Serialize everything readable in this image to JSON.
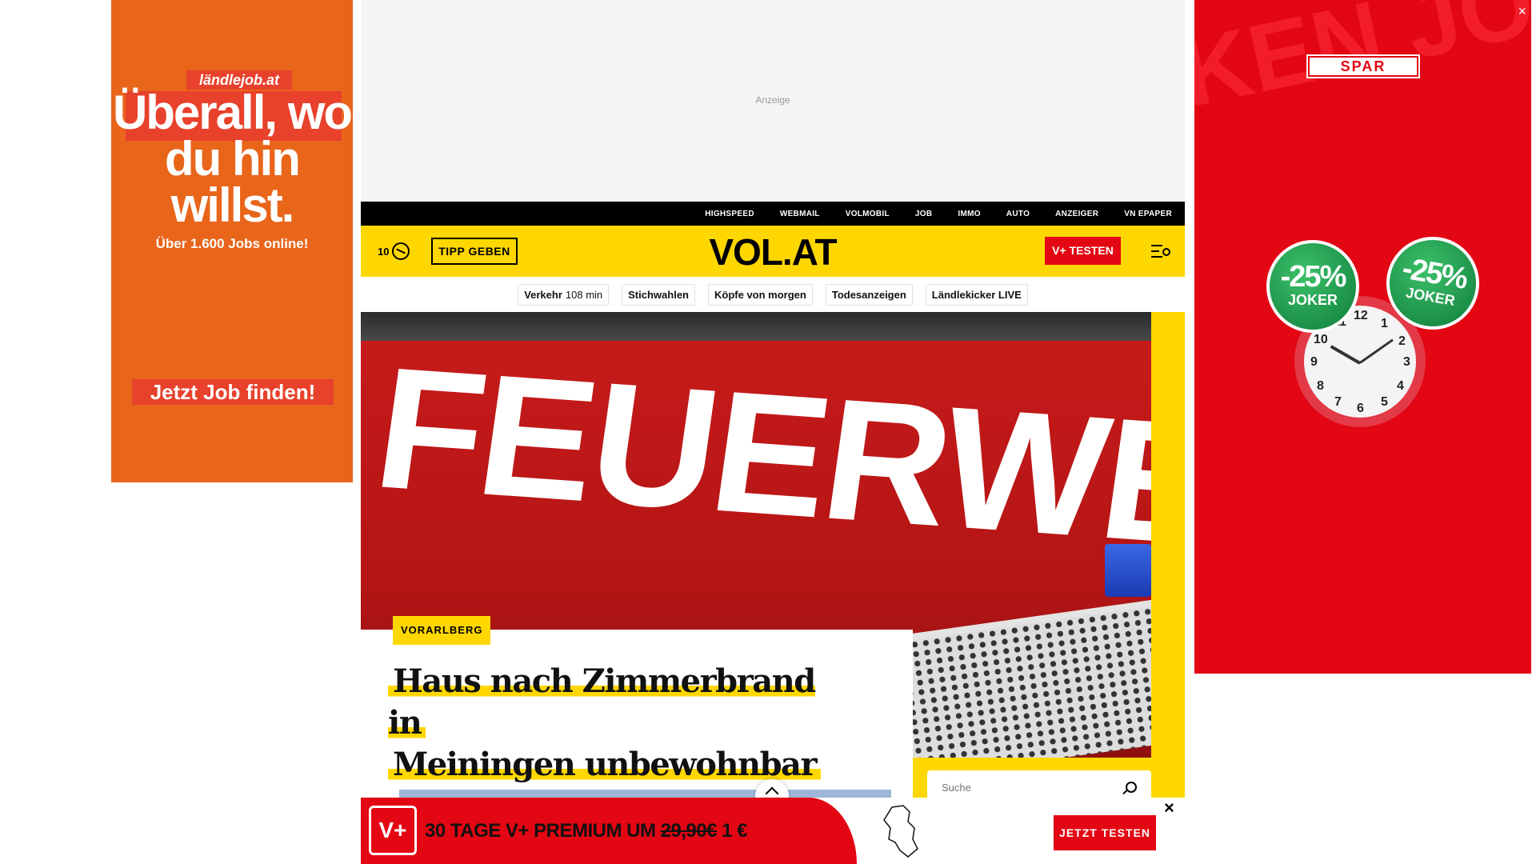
{
  "left_ad": {
    "brand": "ländlejob.at",
    "headline": "Überall, wo du hin willst.",
    "subline": "Über 1.600 Jobs online!",
    "cta": "Jetzt Job finden!"
  },
  "right_ad": {
    "brand": "SPAR",
    "badge1_pct": "-25%",
    "badge1_label": "JOKER",
    "badge2_pct": "-25%",
    "badge2_label": "JOKER",
    "background_text": "KEN JOKER JOKEN JO",
    "close": "×"
  },
  "top_ad": {
    "label": "Anzeige"
  },
  "topbar": {
    "links": [
      "HIGHSPEED",
      "WEBMAIL",
      "VOLMOBIL",
      "JOB",
      "IMMO",
      "AUTO",
      "ANZEIGER",
      "VN EPAPER"
    ]
  },
  "header": {
    "temperature": "10",
    "weather_icon": "weather-icon",
    "tipp_button": "TIPP GEBEN",
    "logo": "VOL.AT",
    "vplus_button": "V+ TESTEN",
    "menu_icon": "menu-search-icon"
  },
  "chipnav": {
    "traffic_label": "Verkehr",
    "traffic_value": "108 min",
    "chips": [
      "Stichwahlen",
      "Köpfe von morgen",
      "Todesanzeigen",
      "Ländlekicker LIVE"
    ]
  },
  "hero": {
    "image_word": "FEUERWEHR",
    "tag": "VORARLBERG",
    "headline_line1": "Haus nach Zimmerbrand in",
    "headline_line2": "Meiningen unbewohnbar",
    "search_placeholder": "Suche"
  },
  "promo": {
    "logo": "V+",
    "text_main": "30 TAGE V+ PREMIUM UM ",
    "text_old_price": "29,90€",
    "text_new_price": " 1 €",
    "cta": "JETZT TESTEN",
    "close": "×"
  },
  "colors": {
    "brand_yellow": "#ffd700",
    "brand_red": "#e30613",
    "ad_orange": "#e8651a"
  }
}
